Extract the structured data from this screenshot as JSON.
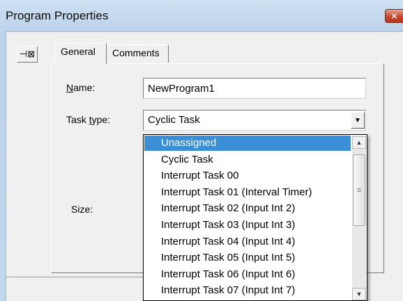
{
  "window": {
    "title": "Program Properties",
    "close_icon": "close-icon"
  },
  "toolbar": {
    "pin_icon": "pin-icon",
    "pin_glyph": "⊣⊠"
  },
  "tabs": [
    {
      "label": "General",
      "active": true
    },
    {
      "label": "Comments",
      "active": false
    }
  ],
  "form": {
    "name_label_accel": "N",
    "name_label_rest": "ame:",
    "name_value": "NewProgram1",
    "task_type_label_pre": "Task ",
    "task_type_label_accel": "t",
    "task_type_label_rest": "ype:",
    "task_type_value": "Cyclic Task",
    "size_label": "Size:"
  },
  "dropdown": {
    "options": [
      "Unassigned",
      "Cyclic Task",
      "Interrupt Task 00",
      "Interrupt Task 01 (Interval Timer)",
      "Interrupt Task 02 (Input Int 2)",
      "Interrupt Task 03 (Input Int 3)",
      "Interrupt Task 04 (Input Int 4)",
      "Interrupt Task 05 (Input Int 5)",
      "Interrupt Task 06 (Input Int 6)",
      "Interrupt Task 07 (Input Int 7)"
    ],
    "selected_index": 0,
    "selection_color": "#3a8fd6"
  }
}
